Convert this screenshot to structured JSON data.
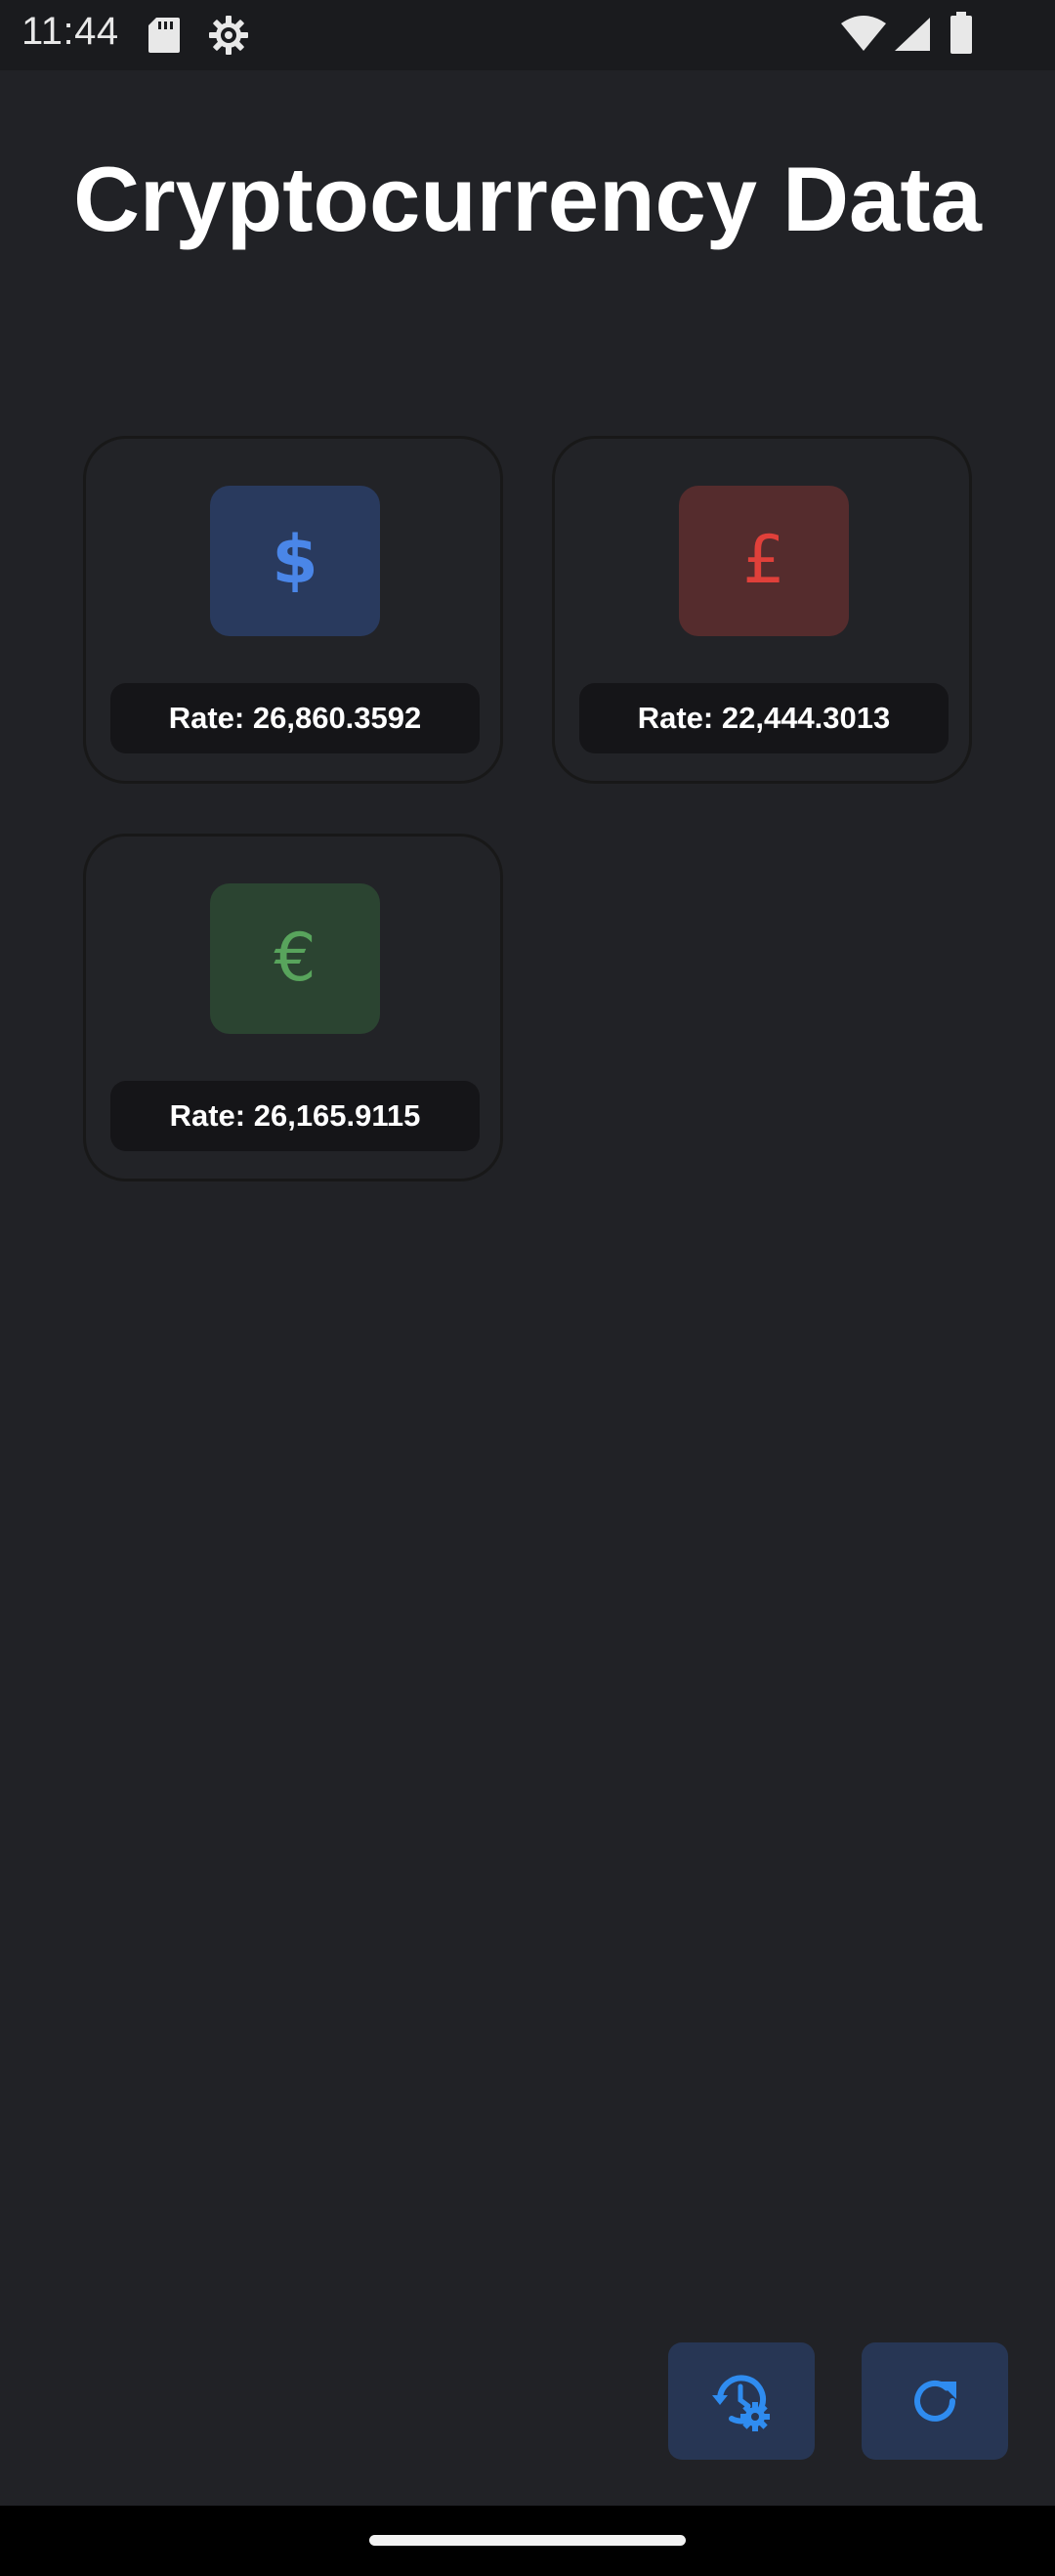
{
  "status_bar": {
    "time": "11:44",
    "left_icons": [
      "sd-card-icon",
      "settings-gear-icon"
    ],
    "right_icons": [
      "wifi-icon",
      "cell-signal-icon",
      "battery-icon"
    ]
  },
  "page": {
    "title": "Cryptocurrency Data"
  },
  "cards": [
    {
      "currency_symbol": "$",
      "icon": "dollar-icon",
      "rate_text": "Rate: 26,860.3592",
      "accent": "#4a86e8",
      "tile_bg": "#293a5e"
    },
    {
      "currency_symbol": "£",
      "icon": "pound-icon",
      "rate_text": "Rate: 22,444.3013",
      "accent": "#e0403a",
      "tile_bg": "#552c2d"
    },
    {
      "currency_symbol": "€",
      "icon": "euro-icon",
      "rate_text": "Rate: 26,165.9115",
      "accent": "#58a45c",
      "tile_bg": "#2b4431"
    }
  ],
  "actions": [
    {
      "name": "history-settings-button",
      "icon": "history-settings-icon"
    },
    {
      "name": "refresh-button",
      "icon": "refresh-icon"
    }
  ],
  "colors": {
    "background": "#212226",
    "fab_bg": "#273654",
    "fab_icon": "#2f8cf0"
  }
}
